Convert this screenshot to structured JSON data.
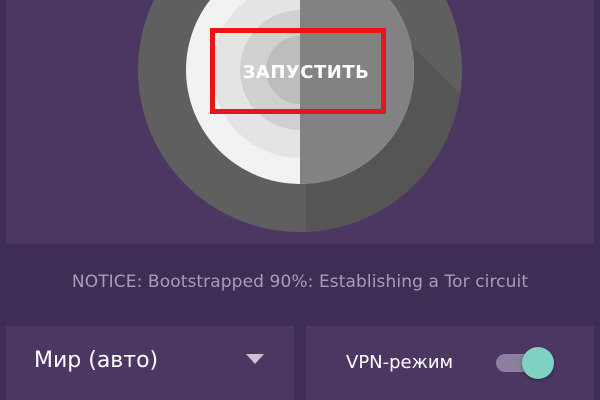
{
  "start_button": {
    "label": "ЗАПУСТИТЬ"
  },
  "status": {
    "text": "NOTICE: Bootstrapped 90%: Establishing a Tor circuit"
  },
  "region": {
    "selected": "Мир (авто)"
  },
  "vpn": {
    "label": "VPN-режим",
    "enabled": true
  },
  "colors": {
    "background": "#3e2d55",
    "card": "#4b3762",
    "highlight": "#e8151b",
    "toggle_accent": "#7fd1c2"
  }
}
